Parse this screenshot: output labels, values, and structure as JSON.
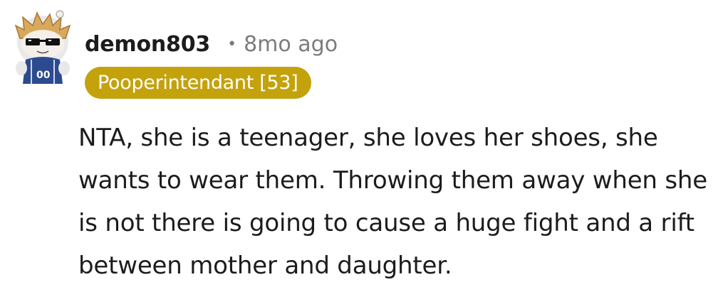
{
  "comment": {
    "author": "demon803",
    "separator": "•",
    "timestamp": "8mo ago",
    "flair": "Pooperintendant [53]",
    "flair_color": "#c4a20c",
    "text": "NTA, she is a teenager, she loves her shoes, she wants to wear them. Throwing them away when she is not there is going to cause a huge fight and a rift between mother and daughter."
  },
  "avatar": {
    "icon": "snoo-avatar-icon",
    "jersey_number": "00"
  }
}
